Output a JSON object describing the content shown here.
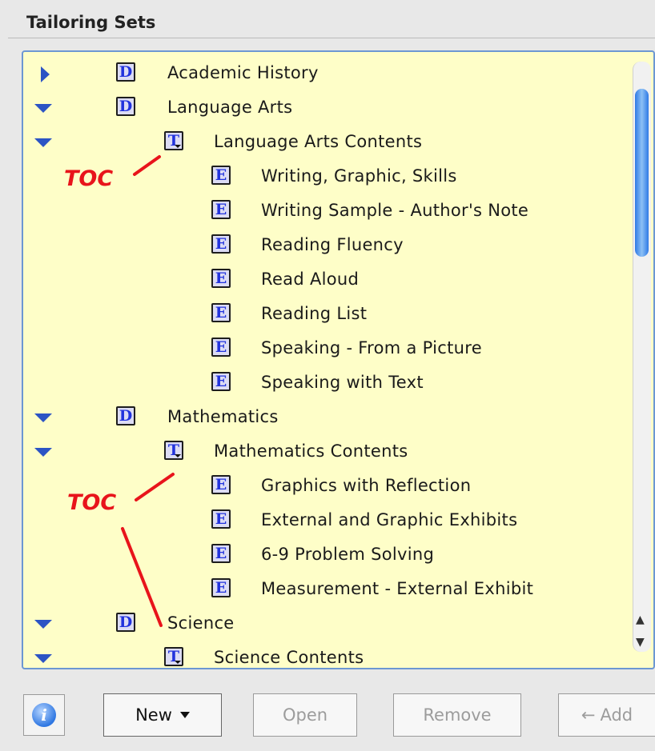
{
  "panel": {
    "title": "Tailoring Sets"
  },
  "tree": {
    "items": [
      {
        "label": "Academic History",
        "icon": "D",
        "expanded": false
      },
      {
        "label": "Language Arts",
        "icon": "D",
        "expanded": true
      },
      {
        "label": "Language Arts Contents",
        "icon": "T",
        "expanded": true
      },
      {
        "label": "Writing, Graphic, Skills",
        "icon": "E"
      },
      {
        "label": "Writing Sample - Author's Note",
        "icon": "E"
      },
      {
        "label": "Reading Fluency",
        "icon": "E"
      },
      {
        "label": "Read Aloud",
        "icon": "E"
      },
      {
        "label": "Reading List",
        "icon": "E"
      },
      {
        "label": "Speaking - From a Picture",
        "icon": "E"
      },
      {
        "label": "Speaking  with Text",
        "icon": "E"
      },
      {
        "label": "Mathematics",
        "icon": "D",
        "expanded": true
      },
      {
        "label": "Mathematics Contents",
        "icon": "T",
        "expanded": true
      },
      {
        "label": "Graphics with Reflection",
        "icon": "E"
      },
      {
        "label": "External and Graphic Exhibits",
        "icon": "E"
      },
      {
        "label": "6-9 Problem Solving",
        "icon": "E"
      },
      {
        "label": "Measurement - External Exhibit",
        "icon": "E"
      },
      {
        "label": "Science",
        "icon": "D",
        "expanded": true
      },
      {
        "label": "Science Contents",
        "icon": "T",
        "expanded": true
      }
    ]
  },
  "annotations": {
    "toc_1": "TOC",
    "toc_2": "TOC"
  },
  "toolbar": {
    "info_icon": "i",
    "new_label": "New",
    "open_label": "Open",
    "remove_label": "Remove",
    "add_label": "Add",
    "add_arrow": "←"
  },
  "colors": {
    "tree_background": "#fefec8",
    "expand_triangle": "#2c54c4",
    "annotation_red": "#e8141b",
    "selection_border": "#6c97d2"
  },
  "icons": {
    "document_icon": "D",
    "toc_icon": "T",
    "exhibit_icon": "E",
    "expand_triangle": "triangle-icon"
  }
}
